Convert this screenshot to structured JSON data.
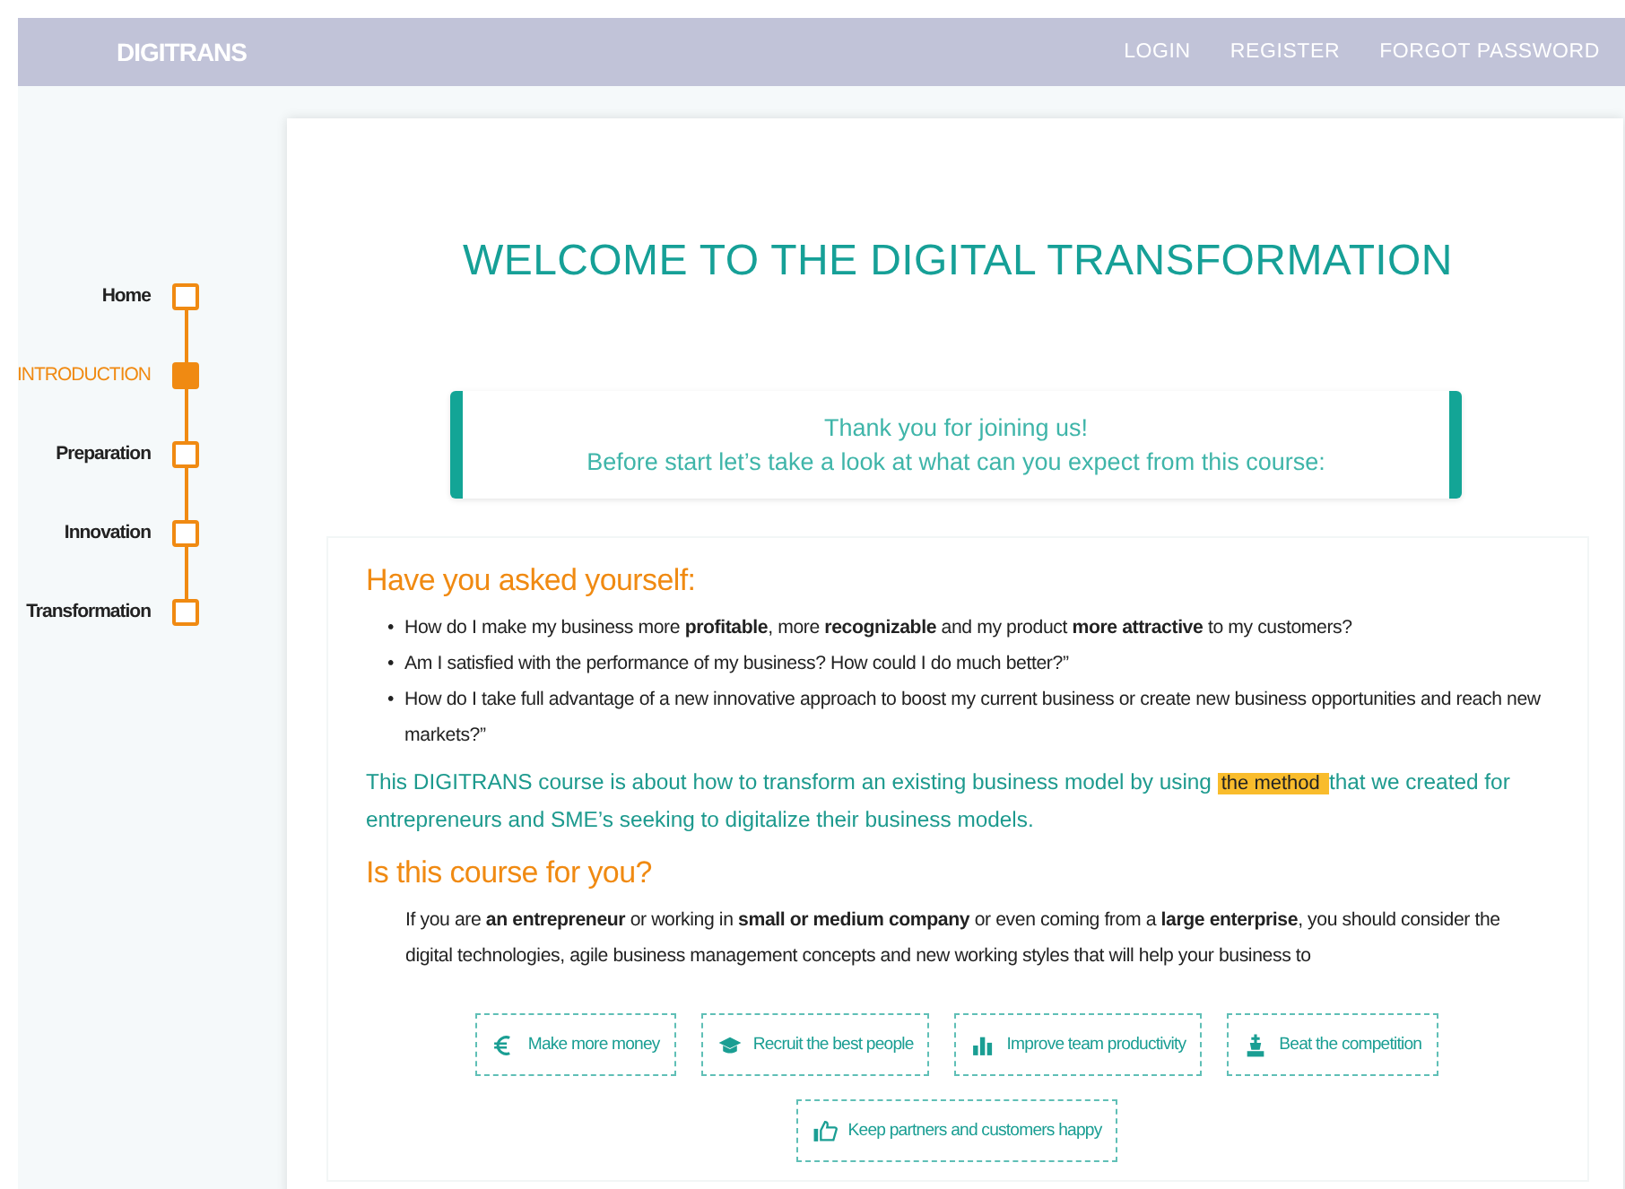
{
  "navbar": {
    "brand": "DIGITRANS",
    "links": [
      "LOGIN",
      "REGISTER",
      "FORGOT PASSWORD"
    ]
  },
  "steps": [
    {
      "label": "Home",
      "selected": false
    },
    {
      "label": "INTRODUCTION",
      "selected": true
    },
    {
      "label": "Preparation",
      "selected": false
    },
    {
      "label": "Innovation",
      "selected": false
    },
    {
      "label": "Transformation",
      "selected": false
    }
  ],
  "title": "WELCOME TO THE DIGITAL TRANSFORMATION",
  "callout": [
    "Thank you for joining us!",
    "Before start let’s take a look at what can you expect from this course:"
  ],
  "section1": {
    "heading": "Have you asked yourself:",
    "bullets": [
      {
        "marker": "•",
        "text": "How do I make my business more **profitable**, more **recognizable** and my product **more attractive** to my customers?"
      },
      {
        "marker": "•",
        "text": "Am I satisfied with the performance of my business? How could I do much better?”"
      },
      {
        "marker": "•",
        "text": "How do I take full advantage of a new innovative approach to boost my current business or create new business opportunities and reach new markets?”"
      }
    ],
    "intro": {
      "before": "This DIGITRANS course is about how to transform an existing business model by using ",
      "highlight": "the method ",
      "after": " that we created for entrepreneurs and SME’s seeking to digitalize their business models."
    }
  },
  "section2": {
    "heading": "Is this course for you?",
    "text": "If you are **an entrepreneur** or working in **small or medium company** or even coming from a **large enterprise**, you should consider the digital technologies, agile business management concepts and new working styles that will help your business to",
    "buttons": [
      {
        "label": "Make more money",
        "kind": "money"
      },
      {
        "label": "Recruit the best people",
        "kind": "people"
      },
      {
        "label": "Improve team productivity",
        "kind": "productivity"
      },
      {
        "label": "Beat the competition",
        "kind": "competition"
      },
      {
        "label": "Keep partners and customers happy",
        "kind": "happy"
      }
    ]
  }
}
